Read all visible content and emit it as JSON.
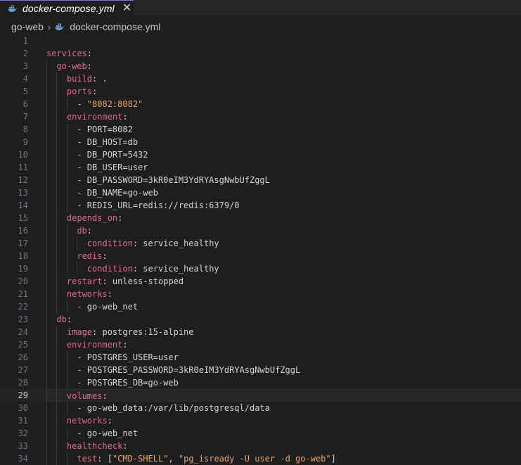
{
  "tab": {
    "filename": "docker-compose.yml",
    "close": "✕"
  },
  "breadcrumb": {
    "folder": "go-web",
    "separator": "›",
    "file": "docker-compose.yml"
  },
  "lines": [
    {
      "n": "1",
      "indent": 0,
      "parts": []
    },
    {
      "n": "2",
      "indent": 0,
      "parts": [
        {
          "t": "k",
          "v": "services"
        },
        {
          "t": "p",
          "v": ":"
        }
      ]
    },
    {
      "n": "3",
      "indent": 1,
      "parts": [
        {
          "t": "k",
          "v": "go-web"
        },
        {
          "t": "p",
          "v": ":"
        }
      ]
    },
    {
      "n": "4",
      "indent": 2,
      "parts": [
        {
          "t": "k",
          "v": "build"
        },
        {
          "t": "p",
          "v": ": ."
        }
      ]
    },
    {
      "n": "5",
      "indent": 2,
      "parts": [
        {
          "t": "k",
          "v": "ports"
        },
        {
          "t": "p",
          "v": ":"
        }
      ]
    },
    {
      "n": "6",
      "indent": 3,
      "parts": [
        {
          "t": "p",
          "v": "- "
        },
        {
          "t": "s",
          "v": "\"8082:8082\""
        }
      ]
    },
    {
      "n": "7",
      "indent": 2,
      "parts": [
        {
          "t": "k",
          "v": "environment"
        },
        {
          "t": "p",
          "v": ":"
        }
      ]
    },
    {
      "n": "8",
      "indent": 3,
      "parts": [
        {
          "t": "p",
          "v": "- PORT=8082"
        }
      ]
    },
    {
      "n": "9",
      "indent": 3,
      "parts": [
        {
          "t": "p",
          "v": "- DB_HOST=db"
        }
      ]
    },
    {
      "n": "10",
      "indent": 3,
      "parts": [
        {
          "t": "p",
          "v": "- DB_PORT=5432"
        }
      ]
    },
    {
      "n": "11",
      "indent": 3,
      "parts": [
        {
          "t": "p",
          "v": "- DB_USER=user"
        }
      ]
    },
    {
      "n": "12",
      "indent": 3,
      "parts": [
        {
          "t": "p",
          "v": "- DB_PASSWORD=3kR0eIM3YdRYAsgNwbUfZggL"
        }
      ]
    },
    {
      "n": "13",
      "indent": 3,
      "parts": [
        {
          "t": "p",
          "v": "- DB_NAME=go-web"
        }
      ]
    },
    {
      "n": "14",
      "indent": 3,
      "parts": [
        {
          "t": "p",
          "v": "- REDIS_URL=redis://redis:6379/0"
        }
      ]
    },
    {
      "n": "15",
      "indent": 2,
      "parts": [
        {
          "t": "k",
          "v": "depends_on"
        },
        {
          "t": "p",
          "v": ":"
        }
      ]
    },
    {
      "n": "16",
      "indent": 3,
      "parts": [
        {
          "t": "k",
          "v": "db"
        },
        {
          "t": "p",
          "v": ":"
        }
      ]
    },
    {
      "n": "17",
      "indent": 4,
      "parts": [
        {
          "t": "k",
          "v": "condition"
        },
        {
          "t": "p",
          "v": ": service_healthy"
        }
      ]
    },
    {
      "n": "18",
      "indent": 3,
      "parts": [
        {
          "t": "k",
          "v": "redis"
        },
        {
          "t": "p",
          "v": ":"
        }
      ]
    },
    {
      "n": "19",
      "indent": 4,
      "parts": [
        {
          "t": "k",
          "v": "condition"
        },
        {
          "t": "p",
          "v": ": service_healthy"
        }
      ]
    },
    {
      "n": "20",
      "indent": 2,
      "parts": [
        {
          "t": "k",
          "v": "restart"
        },
        {
          "t": "p",
          "v": ": unless-stopped"
        }
      ]
    },
    {
      "n": "21",
      "indent": 2,
      "parts": [
        {
          "t": "k",
          "v": "networks"
        },
        {
          "t": "p",
          "v": ":"
        }
      ]
    },
    {
      "n": "22",
      "indent": 3,
      "parts": [
        {
          "t": "p",
          "v": "- go-web_net"
        }
      ]
    },
    {
      "n": "23",
      "indent": 1,
      "parts": [
        {
          "t": "k",
          "v": "db"
        },
        {
          "t": "p",
          "v": ":"
        }
      ]
    },
    {
      "n": "24",
      "indent": 2,
      "parts": [
        {
          "t": "k",
          "v": "image"
        },
        {
          "t": "p",
          "v": ": postgres:15-alpine"
        }
      ]
    },
    {
      "n": "25",
      "indent": 2,
      "parts": [
        {
          "t": "k",
          "v": "environment"
        },
        {
          "t": "p",
          "v": ":"
        }
      ]
    },
    {
      "n": "26",
      "indent": 3,
      "parts": [
        {
          "t": "p",
          "v": "- POSTGRES_USER=user"
        }
      ]
    },
    {
      "n": "27",
      "indent": 3,
      "parts": [
        {
          "t": "p",
          "v": "- POSTGRES_PASSWORD=3kR0eIM3YdRYAsgNwbUfZggL"
        }
      ]
    },
    {
      "n": "28",
      "indent": 3,
      "parts": [
        {
          "t": "p",
          "v": "- POSTGRES_DB=go-web"
        }
      ]
    },
    {
      "n": "29",
      "indent": 2,
      "current": true,
      "parts": [
        {
          "t": "k",
          "v": "volumes"
        },
        {
          "t": "p",
          "v": ":"
        }
      ]
    },
    {
      "n": "30",
      "indent": 3,
      "parts": [
        {
          "t": "p",
          "v": "- go-web_data:/var/lib/postgresql/data"
        }
      ]
    },
    {
      "n": "31",
      "indent": 2,
      "parts": [
        {
          "t": "k",
          "v": "networks"
        },
        {
          "t": "p",
          "v": ":"
        }
      ]
    },
    {
      "n": "32",
      "indent": 3,
      "parts": [
        {
          "t": "p",
          "v": "- go-web_net"
        }
      ]
    },
    {
      "n": "33",
      "indent": 2,
      "parts": [
        {
          "t": "k",
          "v": "healthcheck"
        },
        {
          "t": "p",
          "v": ":"
        }
      ]
    },
    {
      "n": "34",
      "indent": 3,
      "parts": [
        {
          "t": "k",
          "v": "test"
        },
        {
          "t": "p",
          "v": ": ["
        },
        {
          "t": "s",
          "v": "\"CMD-SHELL\""
        },
        {
          "t": "p",
          "v": ", "
        },
        {
          "t": "s",
          "v": "\"pg_isready -U user -d go-web\""
        },
        {
          "t": "p",
          "v": "]"
        }
      ]
    }
  ],
  "colors": {
    "key": "#e06c88",
    "string": "#e8a76b",
    "plain": "#d4d4d4",
    "background": "#1e1e1e",
    "tab_accent": "#8a6fd6"
  },
  "icons": {
    "file_icon": "docker-whale-icon",
    "close_icon": "close-icon",
    "separator_icon": "chevron-right-icon"
  }
}
